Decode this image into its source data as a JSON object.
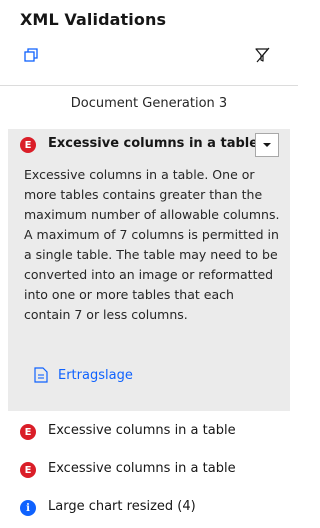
{
  "panel": {
    "title": "XML Validations",
    "copy_icon": "copy-icon",
    "clear_icon": "clear-filter-icon"
  },
  "document_title": "Document Generation 3",
  "expanded_item": {
    "severity": "error",
    "severity_glyph": "E",
    "title": "Excessive columns in a table",
    "description": "Excessive columns in a table. One or more tables contains greater than the maximum number of allowable columns. A maximum of 7 columns is permitted in a single table. The table may need to be converted into an image or reformatted into one or more tables that each contain 7 or less columns.",
    "link_label": "Ertragslage",
    "link_icon": "document-icon",
    "dropdown_icon": "chevron-down-icon"
  },
  "items": [
    {
      "severity": "error",
      "glyph": "E",
      "label": "Excessive columns in a table"
    },
    {
      "severity": "error",
      "glyph": "E",
      "label": "Excessive columns in a table"
    },
    {
      "severity": "info",
      "glyph": "i",
      "label": "Large chart resized (4)"
    }
  ],
  "colors": {
    "error": "#da1e28",
    "info": "#0f62fe",
    "link": "#0f62fe",
    "expanded_bg": "#ebebeb"
  }
}
